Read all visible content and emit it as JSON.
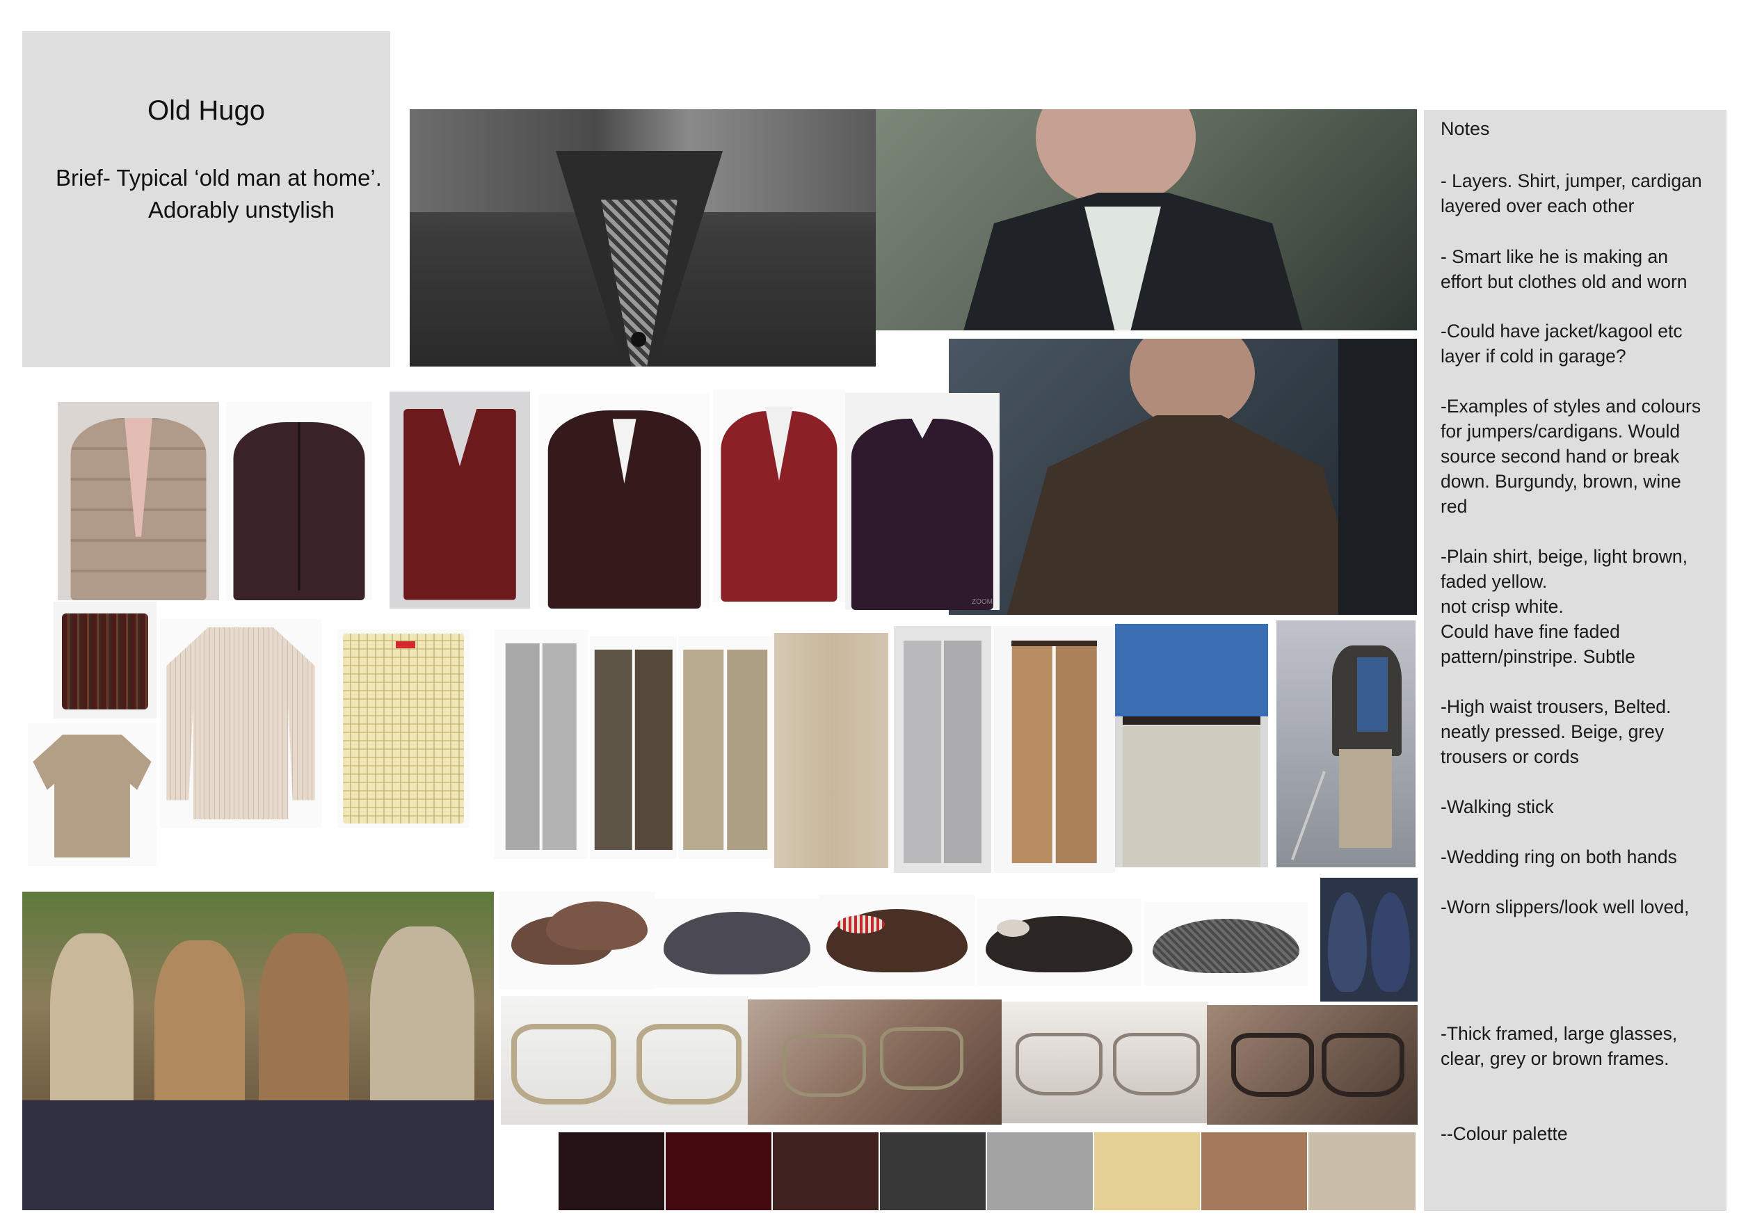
{
  "board": {
    "title": "Old Hugo",
    "brief_line1": "Brief- Typical ‘old man at home’.",
    "brief_line2": "Adorably unstylish"
  },
  "notes": {
    "heading": "Notes",
    "items": [
      "- Layers. Shirt, jumper, cardigan\nlayered over each other",
      "- Smart like he is making an\neffort but clothes old and worn",
      "-Could have jacket/kagool etc\nlayer if cold in garage?",
      "-Examples of styles and colours\nfor jumpers/cardigans. Would\nsource second hand or break\ndown. Burgundy, brown, wine\nred",
      "-Plain shirt, beige, light brown,\nfaded yellow.\nnot crisp white.\nCould have fine faded\npattern/pinstripe. Subtle",
      "-High waist trousers, Belted.\nneatly pressed. Beige, grey\ntrousers or cords",
      "-Walking stick",
      "-Wedding ring on both hands",
      "-Worn slippers/look well loved,",
      "-Thick framed, large glasses,\nclear, grey or brown frames.",
      "--Colour palette"
    ]
  },
  "palette": {
    "colors": [
      "#241214",
      "#420a0e",
      "#3f221f",
      "#383838",
      "#a3a3a3",
      "#e4cf94",
      "#a57a5a",
      "#c9bdaa"
    ]
  },
  "photo_labels": {
    "zoom_caption": "ZOOM"
  }
}
